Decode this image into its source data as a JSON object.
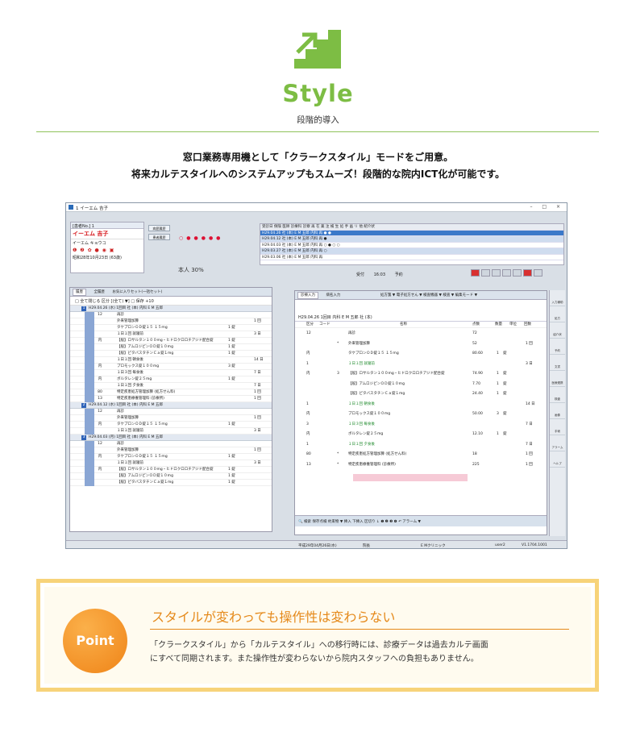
{
  "header": {
    "title": "Style",
    "subtitle": "段階的導入",
    "icon": "stairs-up-arrow-icon",
    "accent_color": "#7dbd44"
  },
  "lead": {
    "line1": "窓口業務専用機として「クラークスタイル」モードをご用意。",
    "line2": "将来カルテスタイルへのシステムアップもスムーズ！段階的な院内ICT化が可能です。"
  },
  "app": {
    "window_title": "1 イーエム 吉子",
    "window_buttons": "– □ ×",
    "patient": {
      "number_label": "[患者No.] 1",
      "name": "イーエム 吉子",
      "kana": "イーエム キョウコ",
      "status_icons": "❶ ❷ ✿ ● ◉ ▣",
      "dob": "昭和28年10月23日 (63歳)"
    },
    "side_buttons": [
      "病歴履歴",
      "患者履歴"
    ],
    "burden": "本人 30%",
    "visits": {
      "headers": "受診日   保険   医師   診療科   診察  再  在  薬  注  検  生  処  手  画  リ  他  紹介状",
      "rows": [
        "H29.04.26 社 (本)  E M 五郎  内科   再  ●        ●",
        "H29.04.12 社 (本)  E M 五郎  内科   再           ●",
        "H29.04.03 社 (本)  E M 五郎  内科   再  ○       ●        ○       ○",
        "H29.03.27 社 (本)  E M 五郎  内科   再           ○",
        "H29.03.06 社 (本)  E M 五郎  内科   再"
      ]
    },
    "reception": {
      "label": "受付",
      "time": "16:03",
      "reserve": "予約"
    },
    "left_panel": {
      "tabs": [
        "履歴",
        "全履歴",
        "お気に入りセット(一括セット)"
      ],
      "options": "□ 全て閉じる  区分 [(全て) ▼]  □ 保存  +10",
      "entries": [
        {
          "no": "1",
          "header": "H29.04.26 (水)  1回目  社 (本)  内科  E M 五郎",
          "rows": [
            [
              "",
              "12",
              "再診",
              "",
              ""
            ],
            [
              "",
              "",
              "外来管理加算",
              "",
              "1 回"
            ],
            [
              "",
              "",
              "タケプロンＯＤ錠１５  １５mg",
              "1 錠",
              ""
            ],
            [
              "",
              "",
              "１日１回 就寝前",
              "",
              "3 日"
            ],
            [
              "21",
              "内",
              "【般】ロサルタン１００mg・ヒドロクロロチアジド配合錠",
              "1 錠",
              ""
            ],
            [
              "",
              "",
              "【般】アムロジピンＯＤ錠１０mg",
              "1 錠",
              ""
            ],
            [
              "",
              "",
              "【般】ピタバスタチンＣａ錠１mg",
              "1 錠",
              ""
            ],
            [
              "",
              "",
              "１日１回 朝食後",
              "",
              "14 日"
            ],
            [
              "21",
              "内",
              "プロモックス錠１００mg",
              "3 錠",
              ""
            ],
            [
              "",
              "",
              "１日３回 毎食後",
              "",
              "7 日"
            ],
            [
              "21",
              "内",
              "ボルタレン錠２５mg",
              "1 錠",
              ""
            ],
            [
              "",
              "",
              "１日１回 夕食後",
              "",
              "7 日"
            ],
            [
              "",
              "80",
              "特定疾患処方管理加算 (処方せん料)",
              "",
              "1 回"
            ],
            [
              "",
              "13",
              "特定疾患療養管理料 (診療所)",
              "",
              "1 回"
            ]
          ]
        },
        {
          "no": "2",
          "header": "H29.04.12 (水)  1回目  社 (本)  内科  E M 五郎",
          "rows": [
            [
              "",
              "12",
              "再診",
              "",
              ""
            ],
            [
              "",
              "",
              "外来管理加算",
              "",
              "1 回"
            ],
            [
              "21",
              "内",
              "タケプロンＯＤ錠１５  １５mg",
              "1 錠",
              ""
            ],
            [
              "",
              "",
              "１日１回 就寝前",
              "",
              "3 日"
            ]
          ]
        },
        {
          "no": "3",
          "header": "H29.04.03 (月)  1回目  社 (本)  内科  E M 五郎",
          "rows": [
            [
              "",
              "12",
              "再診",
              "",
              ""
            ],
            [
              "",
              "",
              "外来管理加算",
              "",
              "1 回"
            ],
            [
              "21",
              "内",
              "タケプロンＯＤ錠１５  １５mg",
              "1 錠",
              ""
            ],
            [
              "",
              "",
              "１日１回 就寝前",
              "",
              "3 日"
            ],
            [
              "21",
              "内",
              "【般】ロサルタン１００mg・ヒドロクロロチアジド配合錠",
              "1 錠",
              ""
            ],
            [
              "",
              "",
              "【般】アムロジピンＯＤ錠１０mg",
              "1 錠",
              ""
            ],
            [
              "",
              "",
              "【般】ピタバスタチンＣａ錠１mg",
              "1 錠",
              ""
            ]
          ]
        }
      ]
    },
    "right_panel": {
      "tabs": [
        "診療入力",
        "病名入力"
      ],
      "toolbar": "処方箋 ▼  電子処方せん ▼  検査機器 ▼  検査 ▼  編集モード ▼",
      "visit_header": "H29.04.26  1回目  内科  E M 五郎     社 (本)",
      "columns": [
        "区分",
        "コード",
        "名称",
        "点数",
        "数量",
        "単位",
        "回数"
      ],
      "rows": [
        {
          "kubun": "12",
          "mark": "",
          "name": "再診",
          "points": "72",
          "qty": "",
          "unit": "",
          "times": "",
          "green": false
        },
        {
          "kubun": "",
          "mark": "*",
          "name": "外来管理加算",
          "points": "52",
          "qty": "",
          "unit": "",
          "times": "1 回",
          "green": false
        },
        {
          "kubun": "内",
          "mark": "",
          "name": "タケプロンＯＤ錠１５  １５mg",
          "points": "80.60",
          "qty": "1",
          "unit": "錠",
          "times": "",
          "green": false
        },
        {
          "kubun": "1",
          "mark": "",
          "name": "１日１回 就寝前",
          "points": "",
          "qty": "",
          "unit": "",
          "times": "3 日",
          "green": true
        },
        {
          "kubun": "内",
          "mark": "3",
          "name": "【般】ロサルタン１００mg・ヒドロクロロチアジド配合錠",
          "points": "74.90",
          "qty": "1",
          "unit": "錠",
          "times": "",
          "green": false
        },
        {
          "kubun": "",
          "mark": "",
          "name": "【般】アムロジピンＯＤ錠１０mg",
          "points": "7.70",
          "qty": "1",
          "unit": "錠",
          "times": "",
          "green": false
        },
        {
          "kubun": "",
          "mark": "",
          "name": "【般】ピタバスタチンＣａ錠１mg",
          "points": "24.40",
          "qty": "1",
          "unit": "錠",
          "times": "",
          "green": false
        },
        {
          "kubun": "1",
          "mark": "",
          "name": "１日１回 朝食後",
          "points": "",
          "qty": "",
          "unit": "",
          "times": "14 日",
          "green": true
        },
        {
          "kubun": "内",
          "mark": "",
          "name": "プロモックス錠１００mg",
          "points": "50.00",
          "qty": "3",
          "unit": "錠",
          "times": "",
          "green": false
        },
        {
          "kubun": "3",
          "mark": "",
          "name": "１日３回 毎食後",
          "points": "",
          "qty": "",
          "unit": "",
          "times": "7 日",
          "green": true
        },
        {
          "kubun": "内",
          "mark": "",
          "name": "ボルタレン錠２５mg",
          "points": "12.10",
          "qty": "1",
          "unit": "錠",
          "times": "",
          "green": false
        },
        {
          "kubun": "1",
          "mark": "",
          "name": "１日１回 夕食後",
          "points": "",
          "qty": "",
          "unit": "",
          "times": "7 日",
          "green": true
        },
        {
          "kubun": "80",
          "mark": "*",
          "name": "特定疾患処方管理加算 (処方せん料)",
          "points": "18",
          "qty": "",
          "unit": "",
          "times": "1 回",
          "green": false
        },
        {
          "kubun": "13",
          "mark": "*",
          "name": "特定疾患療養管理料 (診療所)",
          "points": "225",
          "qty": "",
          "unit": "",
          "times": "1 回",
          "green": false
        }
      ],
      "footer": "🔍 検索   保存点検   約束物 ▼  挿入  下挿入  区切り  ↓  ❶ ❷ ❸ ❹  ↶  アラーム ▼"
    },
    "vertical_toolbar": [
      "入力補助",
      "処方",
      "紹介状",
      "予約",
      "文書",
      "医療連携",
      "検査",
      "画像",
      "手術",
      "アラーム",
      "ヘルプ"
    ],
    "status": {
      "date": "平成29年04月26日(水)",
      "doctor": "院長",
      "clinic": "E Mクリニック",
      "user": "user2",
      "version": "V1.1704.1001"
    }
  },
  "point": {
    "badge": "Point",
    "title": "スタイルが変わっても操作性は変わらない",
    "body_line1": "「クラークスタイル」から「カルテスタイル」への移行時には、診療データは過去カルテ画面",
    "body_line2": "にすべて同期されます。また操作性が変わらないから院内スタッフへの負担もありません。",
    "accent_color": "#e5891a",
    "frame_color": "#f7d37a"
  }
}
